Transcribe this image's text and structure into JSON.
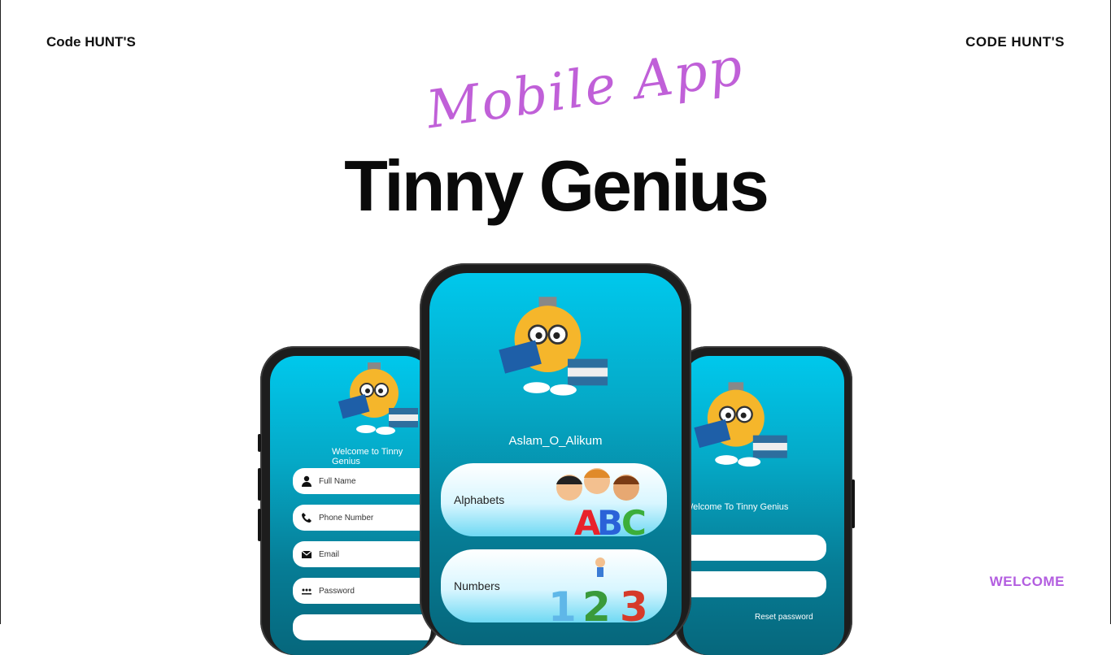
{
  "header": {
    "brand_left": "Code HUNT'S",
    "brand_right": "CODE HUNT'S"
  },
  "hero": {
    "script_title": "Mobile App",
    "main_title": "Tinny Genius"
  },
  "footer": {
    "welcome_tag": "WELCOME"
  },
  "left_phone": {
    "welcome": "Welcome to Tinny Genius",
    "fields": [
      {
        "label": "Full Name",
        "icon": "person-icon"
      },
      {
        "label": "Phone Number",
        "icon": "phone-icon"
      },
      {
        "label": "Email",
        "icon": "mail-icon"
      },
      {
        "label": "Password",
        "icon": "password-icon"
      }
    ]
  },
  "center_phone": {
    "greeting": "Aslam_O_Alikum",
    "cards": [
      {
        "label": "Alphabets",
        "art": "ABC"
      },
      {
        "label": "Numbers",
        "art": "123"
      }
    ]
  },
  "right_phone": {
    "welcome": "Welcome To Tinny Genius",
    "reset_link": "Reset password"
  },
  "colors": {
    "accent_purple": "#c060d8",
    "screen_cyan": "#00c8ec",
    "screen_teal": "#06677c"
  }
}
